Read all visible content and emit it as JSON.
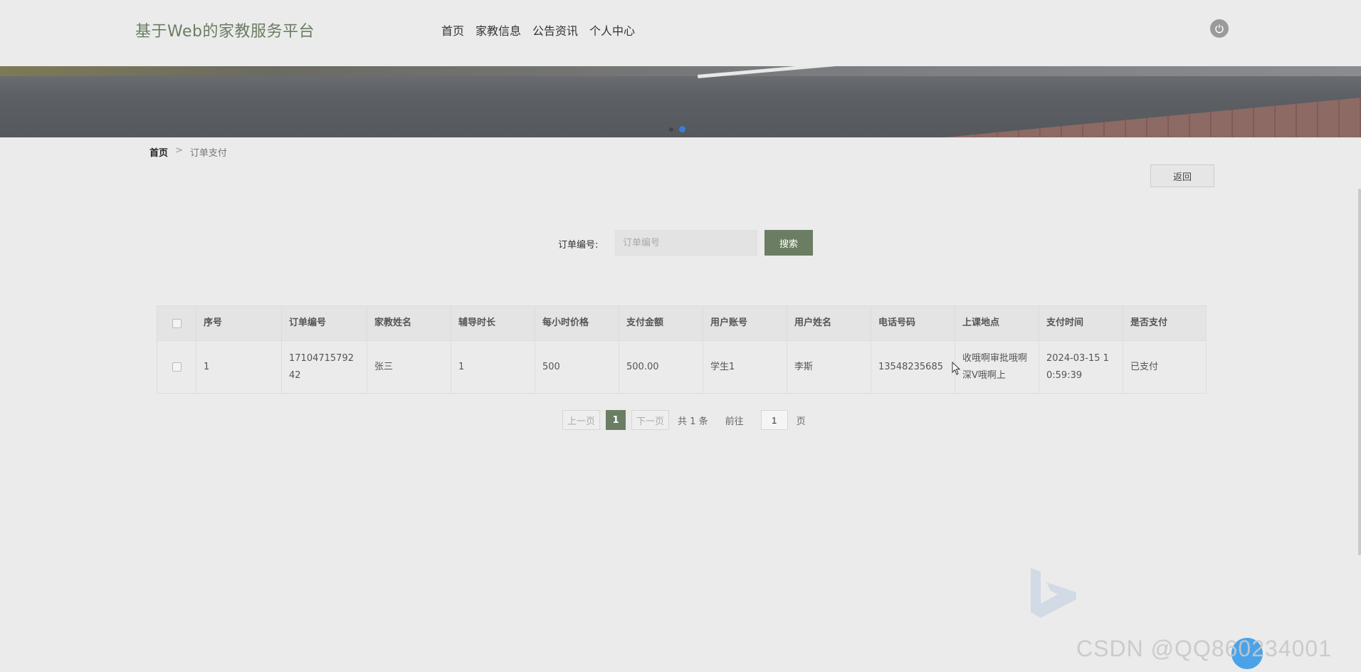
{
  "header": {
    "site_title": "基于Web的家教服务平台",
    "nav": [
      "首页",
      "家教信息",
      "公告资讯",
      "个人中心"
    ]
  },
  "breadcrumb": {
    "home": "首页",
    "separator": ">",
    "current": "订单支付"
  },
  "actions": {
    "back_label": "返回"
  },
  "search": {
    "label": "订单编号:",
    "placeholder": "订单编号",
    "button_label": "搜索"
  },
  "table": {
    "columns": [
      "序号",
      "订单编号",
      "家教姓名",
      "辅导时长",
      "每小时价格",
      "支付金额",
      "用户账号",
      "用户姓名",
      "电话号码",
      "上课地点",
      "支付时间",
      "是否支付"
    ],
    "rows": [
      [
        "1",
        "1710471579242",
        "张三",
        "1",
        "500",
        "500.00",
        "学生1",
        "李斯",
        "13548235685",
        "收哦啊审批哦啊深V哦啊上",
        "2024-03-15 10:59:39",
        "已支付"
      ]
    ]
  },
  "pagination": {
    "prev_label": "上一页",
    "current_page": "1",
    "next_label": "下一页",
    "total_text": "共 1 条",
    "goto_label": "前往",
    "goto_value": "1",
    "page_suffix": "页"
  },
  "watermark": "CSDN @QQ860234001",
  "colors": {
    "accent": "#6b7d62",
    "background": "#ebebeb",
    "carousel_active": "#3a7fd5"
  }
}
